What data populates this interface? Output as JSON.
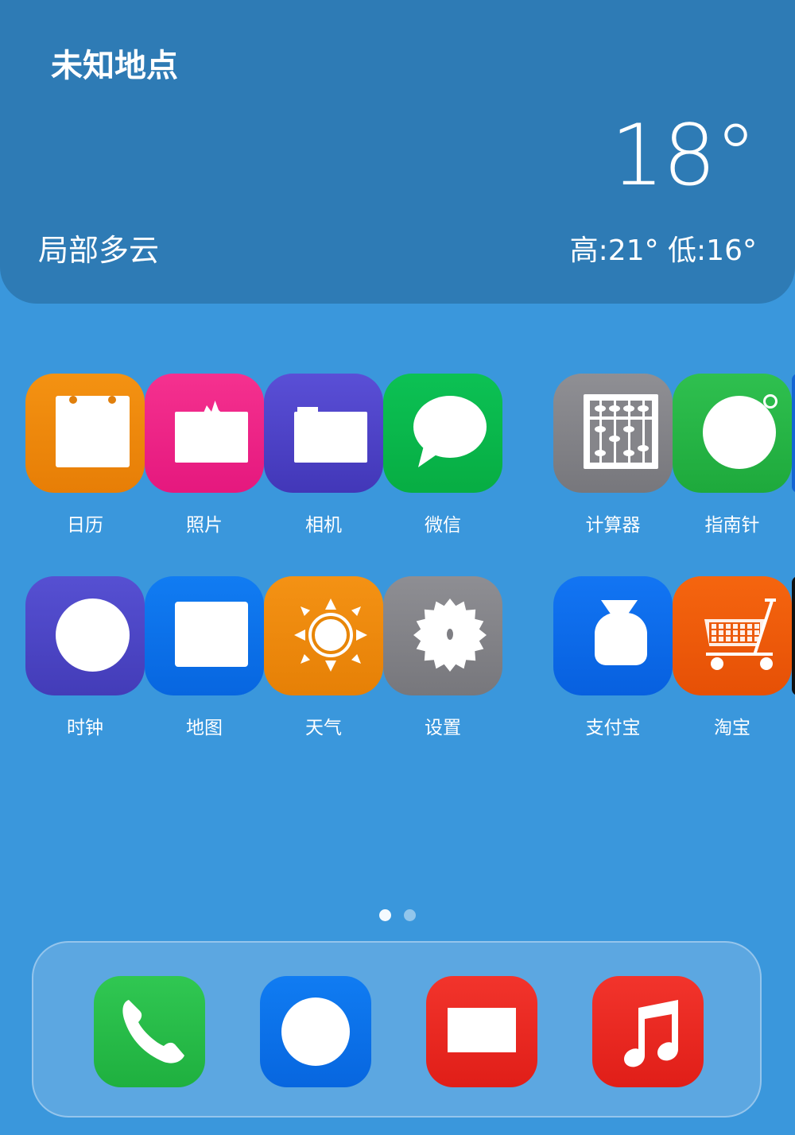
{
  "weather": {
    "location": "未知地点",
    "temperature": "18°",
    "condition": "局部多云",
    "high_low": "高:21° 低:16°"
  },
  "apps": [
    {
      "label": "日历",
      "icon": "calendar-icon",
      "color": "#f08c0b"
    },
    {
      "label": "照片",
      "icon": "photos-icon",
      "color": "#f02a8c"
    },
    {
      "label": "相机",
      "icon": "camera-icon",
      "color": "#4f46c9"
    },
    {
      "label": "微信",
      "icon": "wechat-icon",
      "color": "#0ab94a"
    },
    {
      "label": "计算器",
      "icon": "calculator-icon",
      "color": "#85858a"
    },
    {
      "label": "指南针",
      "icon": "compass-icon",
      "color": "#26b845"
    },
    {
      "label": "时钟",
      "icon": "clock-icon",
      "color": "#4e48c8"
    },
    {
      "label": "地图",
      "icon": "maps-icon",
      "color": "#0a72ee"
    },
    {
      "label": "天气",
      "icon": "weather-icon",
      "color": "#f08a0d"
    },
    {
      "label": "设置",
      "icon": "settings-icon",
      "color": "#85858a"
    },
    {
      "label": "支付宝",
      "icon": "alipay-icon",
      "color": "#0c6ff0"
    },
    {
      "label": "淘宝",
      "icon": "taobao-icon",
      "color": "#f05a0a"
    }
  ],
  "page_indicator": {
    "total_pages": 2,
    "current_page": 1
  },
  "dock": [
    {
      "icon": "phone-icon",
      "color": "#28c04c"
    },
    {
      "icon": "browser-icon",
      "color": "#0a72ee"
    },
    {
      "icon": "video-icon",
      "color": "#ee2a24"
    },
    {
      "icon": "music-icon",
      "color": "#ee2a24"
    }
  ]
}
